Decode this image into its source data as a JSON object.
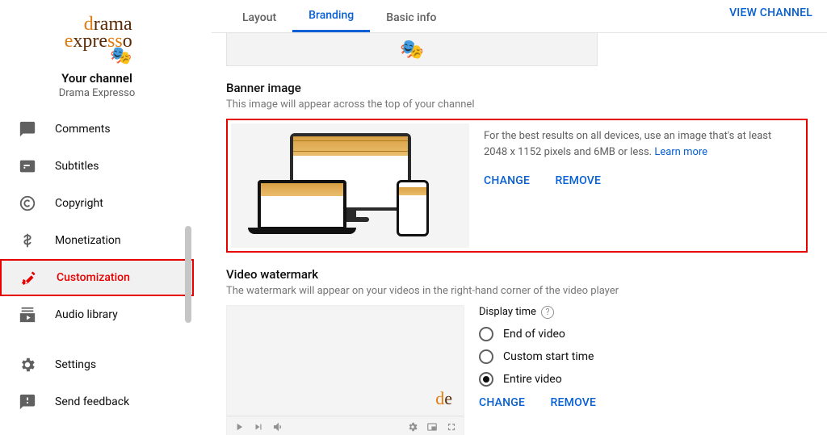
{
  "channel": {
    "logo_name": "drama expresso",
    "your_channel_label": "Your channel",
    "channel_name": "Drama Expresso"
  },
  "sidebar": {
    "items": [
      {
        "label": "Comments",
        "icon": "comment-icon",
        "active": false
      },
      {
        "label": "Subtitles",
        "icon": "subtitles-icon",
        "active": false
      },
      {
        "label": "Copyright",
        "icon": "copyright-icon",
        "active": false
      },
      {
        "label": "Monetization",
        "icon": "monetization-icon",
        "active": false
      },
      {
        "label": "Customization",
        "icon": "customization-icon",
        "active": true
      },
      {
        "label": "Audio library",
        "icon": "audio-library-icon",
        "active": false
      },
      {
        "label": "Settings",
        "icon": "settings-icon",
        "active": false
      },
      {
        "label": "Send feedback",
        "icon": "feedback-icon",
        "active": false
      }
    ]
  },
  "tabs": {
    "items": [
      {
        "label": "Layout",
        "active": false
      },
      {
        "label": "Branding",
        "active": true
      },
      {
        "label": "Basic info",
        "active": false
      }
    ],
    "view_channel_label": "VIEW CHANNEL"
  },
  "banner": {
    "title": "Banner image",
    "subtitle": "This image will appear across the top of your channel",
    "guidance": "For the best results on all devices, use an image that's at least 2048 x 1152 pixels and 6MB or less. ",
    "learn_more_label": "Learn more",
    "change_label": "CHANGE",
    "remove_label": "REMOVE"
  },
  "watermark": {
    "title": "Video watermark",
    "subtitle": "The watermark will appear on your videos in the right-hand corner of the video player",
    "display_time_label": "Display time",
    "options": [
      {
        "label": "End of video",
        "selected": false
      },
      {
        "label": "Custom start time",
        "selected": false
      },
      {
        "label": "Entire video",
        "selected": true
      }
    ],
    "change_label": "CHANGE",
    "remove_label": "REMOVE"
  }
}
